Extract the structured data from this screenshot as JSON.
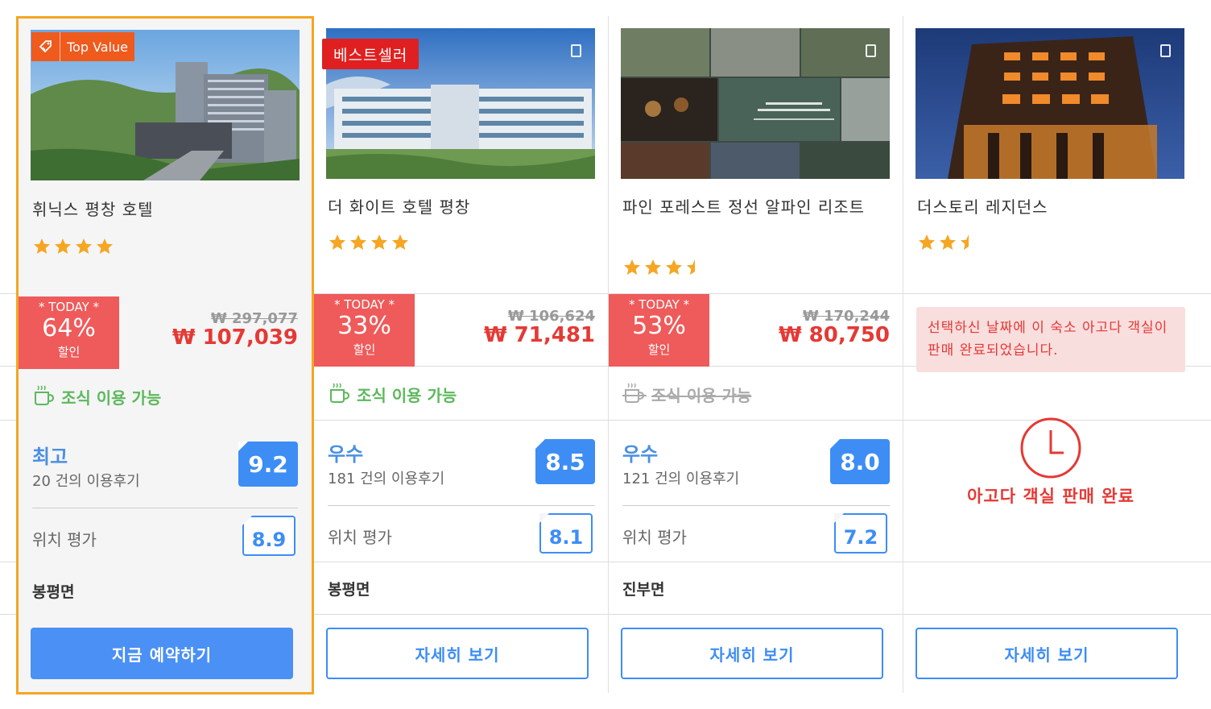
{
  "colors": {
    "highlight_border": "#f5a623",
    "discount_red": "#ef5a5a",
    "price_red": "#e53935",
    "score_blue": "#3d8df5",
    "breakfast_green": "#5cb85c",
    "star_orange": "#f5a623"
  },
  "hotels": [
    {
      "name": "휘닉스 평창 호텔",
      "stars": 4,
      "badge": "Top Value",
      "badge_icon": "tag-icon",
      "discount_top": "* TODAY *",
      "discount_pct": "64%",
      "discount_bottom": "할인",
      "orig_price": "₩ 297,077",
      "price": "₩ 107,039",
      "breakfast": "조식 이용 가능",
      "breakfast_available": true,
      "rating_label": "최고",
      "review_count": "20 건의 이용후기",
      "score": "9.2",
      "location_label": "위치 평가",
      "location_score": "8.9",
      "area": "봉평면",
      "button": "지금 예약하기"
    },
    {
      "name": "더 화이트 호텔 평창",
      "stars": 4,
      "badge": "베스트셀러",
      "discount_top": "* TODAY *",
      "discount_pct": "33%",
      "discount_bottom": "할인",
      "orig_price": "₩ 106,624",
      "price": "₩ 71,481",
      "breakfast": "조식 이용 가능",
      "breakfast_available": true,
      "rating_label": "우수",
      "review_count": "181 건의 이용후기",
      "score": "8.5",
      "location_label": "위치 평가",
      "location_score": "8.1",
      "area": "봉평면",
      "button": "자세히 보기"
    },
    {
      "name": "파인 포레스트 정선 알파인 리조트",
      "stars": 3.5,
      "discount_top": "* TODAY *",
      "discount_pct": "53%",
      "discount_bottom": "할인",
      "orig_price": "₩ 170,244",
      "price": "₩ 80,750",
      "breakfast": "조식 이용 가능",
      "breakfast_available": false,
      "rating_label": "우수",
      "review_count": "121 건의 이용후기",
      "score": "8.0",
      "location_label": "위치 평가",
      "location_score": "7.2",
      "area": "진부면",
      "button": "자세히 보기"
    },
    {
      "name": "더스토리 레지던스",
      "stars": 2.5,
      "sold_message": "선택하신 날짜에 이 숙소 아고다 객실이 판매 완료되었습니다.",
      "sold_label": "아고다 객실 판매 완료",
      "sold_icon": "clock-icon",
      "button": "자세히 보기"
    }
  ]
}
